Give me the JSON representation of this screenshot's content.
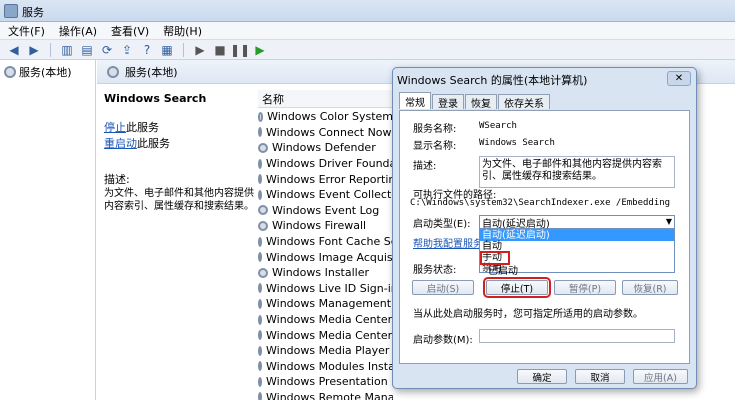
{
  "window": {
    "title": "服务"
  },
  "menu": [
    "文件(F)",
    "操作(A)",
    "查看(V)",
    "帮助(H)"
  ],
  "tree": {
    "root": "服务(本地)"
  },
  "panel": {
    "header": "服务(本地)"
  },
  "detail": {
    "service_name": "Windows Search",
    "stop_link": "停止",
    "stop_suffix": "此服务",
    "restart_link": "重启动",
    "restart_suffix": "此服务",
    "desc_label": "描述:",
    "desc_text": "为文件、电子邮件和其他内容提供内容索引、属性缓存和搜索结果。"
  },
  "list": {
    "column": "名称",
    "items": [
      "Windows Color System",
      "Windows Connect Now - C",
      "Windows Defender",
      "Windows Driver Foundatio",
      "Windows Error Reporting S",
      "Windows Event Collector",
      "Windows Event Log",
      "Windows Firewall",
      "Windows Font Cache Servi",
      "Windows Image Acquisitio",
      "Windows Installer",
      "Windows Live ID Sign-in A",
      "Windows Management Ins",
      "Windows Media Center Re",
      "Windows Media Center Sch",
      "Windows Media Player Ne",
      "Windows Modules Installe",
      "Windows Presentation Fo",
      "Windows Remote Manageme"
    ]
  },
  "dialog": {
    "title": "Windows Search 的属性(本地计算机)",
    "close": "✕",
    "tabs": [
      "常规",
      "登录",
      "恢复",
      "依存关系"
    ],
    "service_name_label": "服务名称:",
    "service_name": "WSearch",
    "display_name_label": "显示名称:",
    "display_name": "Windows Search",
    "desc_label": "描述:",
    "description": "为文件、电子邮件和其他内容提供内容索引、属性缓存和搜索结果。",
    "path_label": "可执行文件的路径:",
    "path": "C:\\Windows\\system32\\SearchIndexer.exe /Embedding",
    "startup_label": "启动类型(E):",
    "startup_value": "自动(延迟启动)",
    "dropdown_options": [
      "自动(延迟启动)",
      "自动",
      "手动",
      "禁用"
    ],
    "help_link": "帮助我配置服务启",
    "status_label": "服务状态:",
    "status_value": "已启动",
    "btn_start": "启动(S)",
    "btn_stop": "停止(T)",
    "btn_pause": "暂停(P)",
    "btn_resume": "恢复(R)",
    "hint": "当从此处启动服务时，您可指定所适用的启动参数。",
    "params_label": "启动参数(M):",
    "btn_ok": "确定",
    "btn_cancel": "取消",
    "btn_apply": "应用(A)"
  }
}
